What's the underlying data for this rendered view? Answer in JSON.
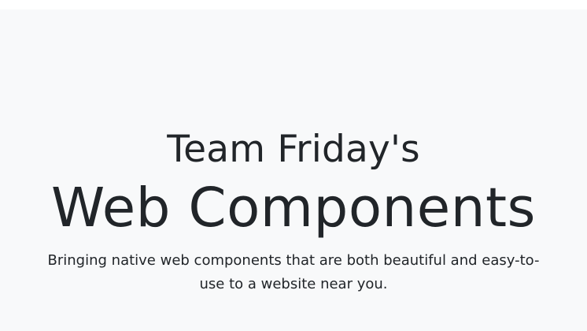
{
  "hero": {
    "kicker": "Team Friday's",
    "title": "Web Components",
    "lead": "Bringing native web components that are both beautiful and easy-to-use to a website near you."
  },
  "colors": {
    "page_bg": "#ffffff",
    "hero_bg": "#f8f9fa",
    "text": "#212529"
  }
}
